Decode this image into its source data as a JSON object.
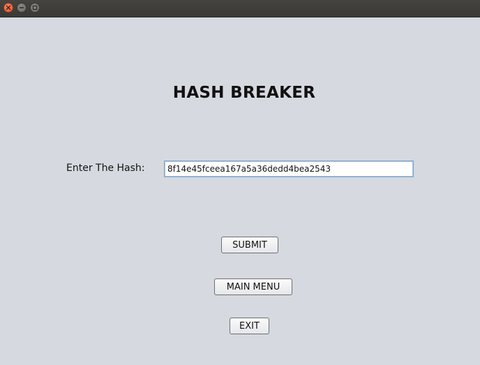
{
  "window": {
    "controls": [
      "close-icon",
      "minimize-icon",
      "maximize-icon"
    ]
  },
  "main": {
    "title": "HASH BREAKER",
    "hash_label": "Enter The Hash:",
    "hash_value": "8f14e45fceea167a5a36dedd4bea2543",
    "submit_label": "SUBMIT",
    "main_menu_label": "MAIN MENU",
    "exit_label": "EXIT"
  },
  "colors": {
    "background": "#d6d9df",
    "titlebar": "#3f3e3a",
    "close_button": "#e1552d",
    "input_border": "#7fa3c9"
  }
}
